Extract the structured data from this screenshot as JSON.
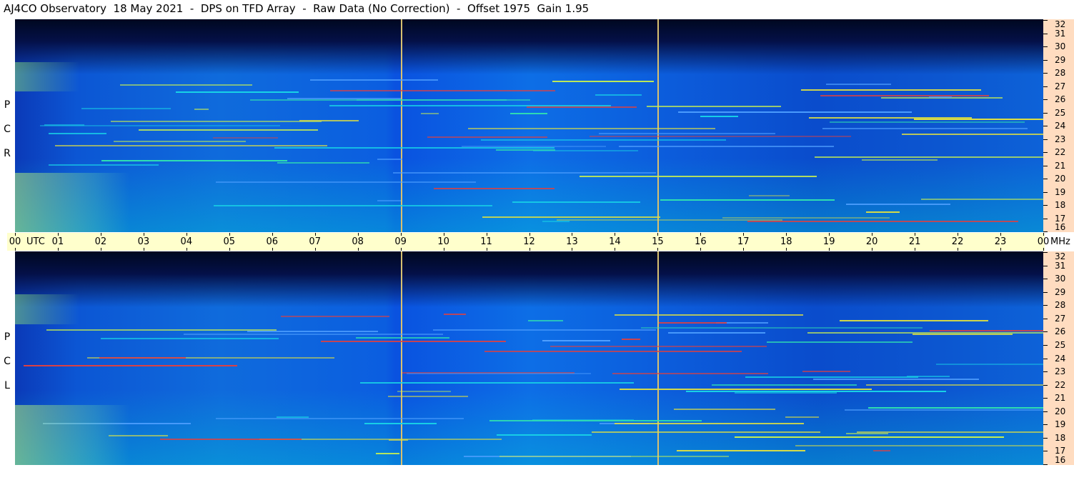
{
  "title": "AJ4CO Observatory  18 May 2021  -  DPS on TFD Array  -  Raw Data (No Correction)  -  Offset 1975  Gain 1.95",
  "chart_data": {
    "type": "heatmap",
    "x_axis": {
      "unit": "UTC",
      "ticks": [
        "00",
        "01",
        "02",
        "03",
        "04",
        "05",
        "06",
        "07",
        "08",
        "09",
        "10",
        "11",
        "12",
        "13",
        "14",
        "15",
        "16",
        "17",
        "18",
        "19",
        "20",
        "21",
        "22",
        "23",
        "00"
      ],
      "range": [
        0,
        24
      ]
    },
    "y_axis": {
      "unit": "MHz",
      "ticks": [
        "16",
        "17",
        "18",
        "19",
        "20",
        "21",
        "22",
        "23",
        "24",
        "25",
        "26",
        "27",
        "28",
        "29",
        "30",
        "31",
        "32"
      ],
      "range": [
        16,
        32
      ]
    },
    "panels": [
      {
        "name": "RCP",
        "letters": [
          "P",
          "C",
          "R"
        ]
      },
      {
        "name": "LCP",
        "letters": [
          "P",
          "C",
          "L"
        ]
      }
    ],
    "cursor_times_utc": [
      9,
      15
    ],
    "colormap": [
      "#000820",
      "#0a3ccc",
      "#0c70e6",
      "#18d2e6",
      "#c8f050",
      "#e04040"
    ]
  }
}
